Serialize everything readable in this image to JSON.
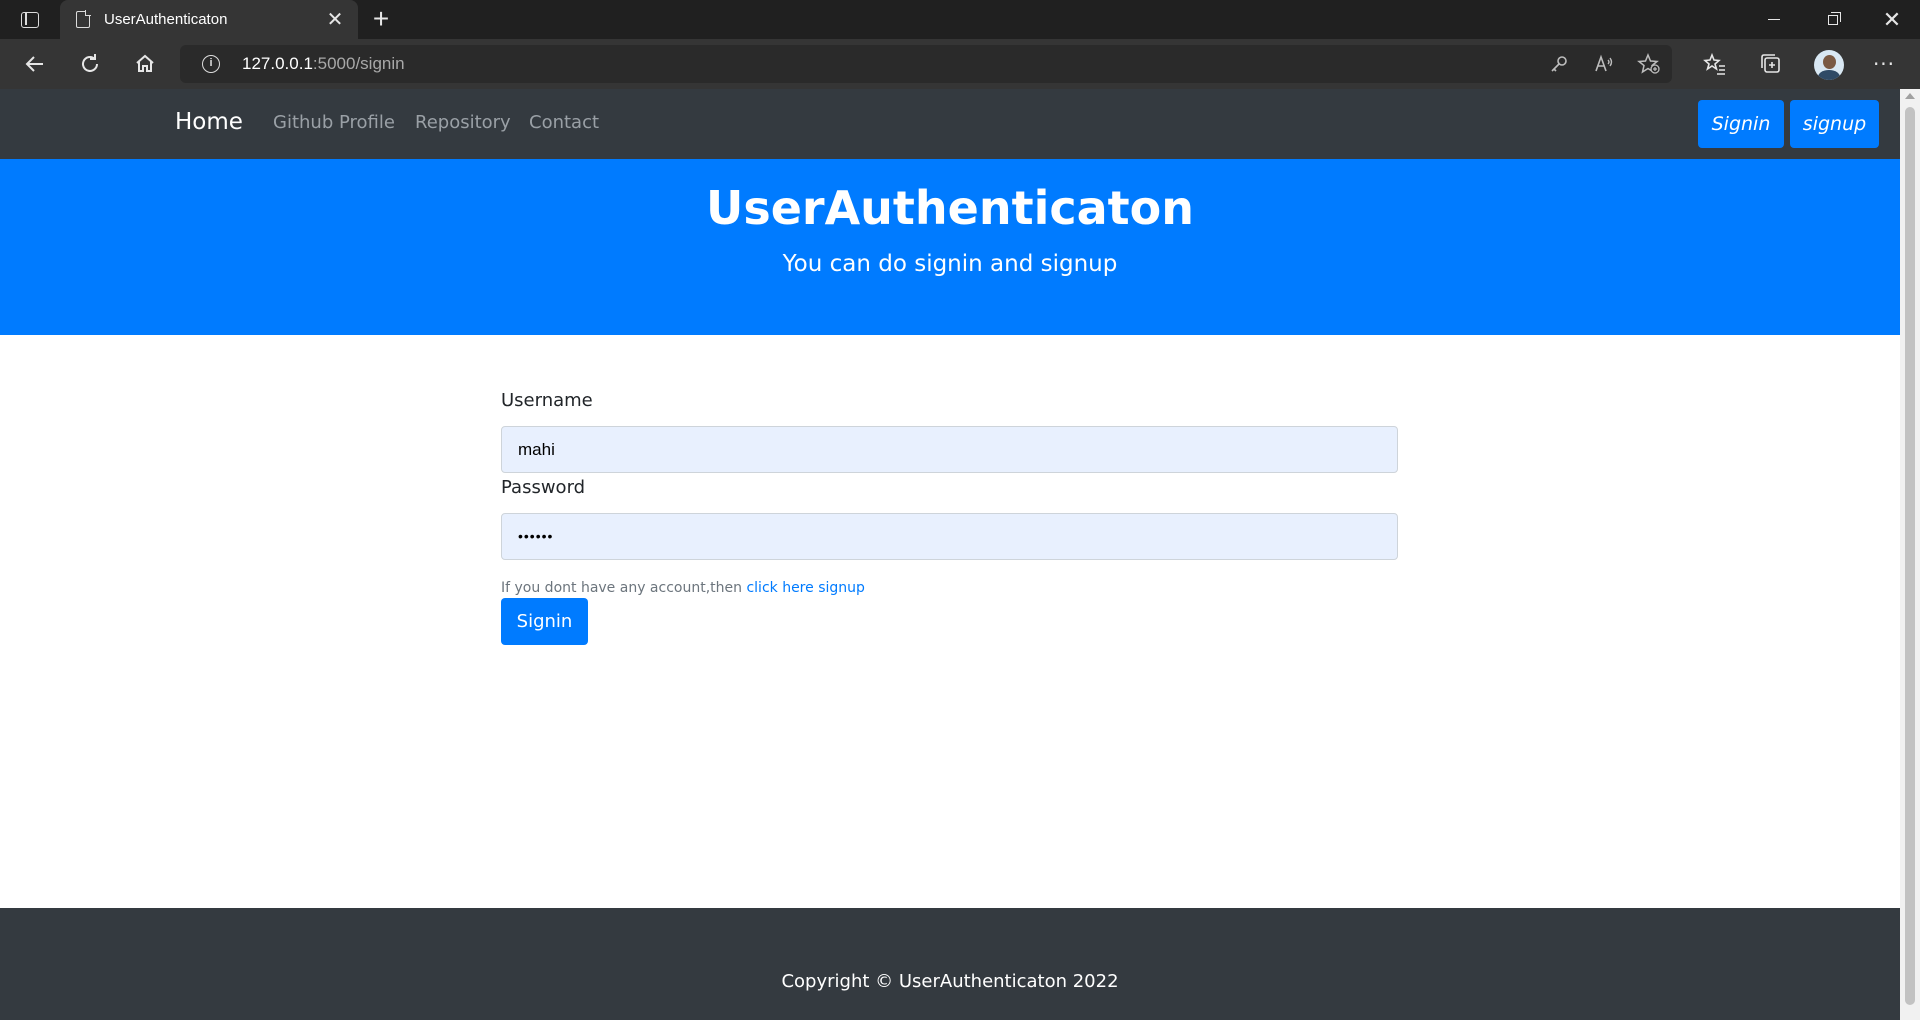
{
  "browser": {
    "tab_title": "UserAuthenticaton",
    "tab_close": "✕",
    "new_tab": "+",
    "window_close": "✕",
    "url_host": "127.0.0.1",
    "url_path": ":5000/signin",
    "url_info": "i",
    "more_menu": "···"
  },
  "navbar": {
    "brand": "Home",
    "links": [
      "Github Profile",
      "Repository",
      "Contact"
    ],
    "signin_label": "Signin",
    "signup_label": "signup"
  },
  "hero": {
    "title": "UserAuthenticaton",
    "subtitle": "You can do signin and signup"
  },
  "form": {
    "username_label": "Username",
    "username_value": "mahi",
    "password_label": "Password",
    "password_value": "••••••",
    "help_text": "If you dont have any account,then ",
    "help_link": "click here signup",
    "submit_label": "Signin"
  },
  "footer": {
    "text": "Copyright © UserAuthenticaton 2022"
  },
  "colors": {
    "primary": "#007bff",
    "dark": "#343a40",
    "input_autofill": "#e8f0fe"
  }
}
